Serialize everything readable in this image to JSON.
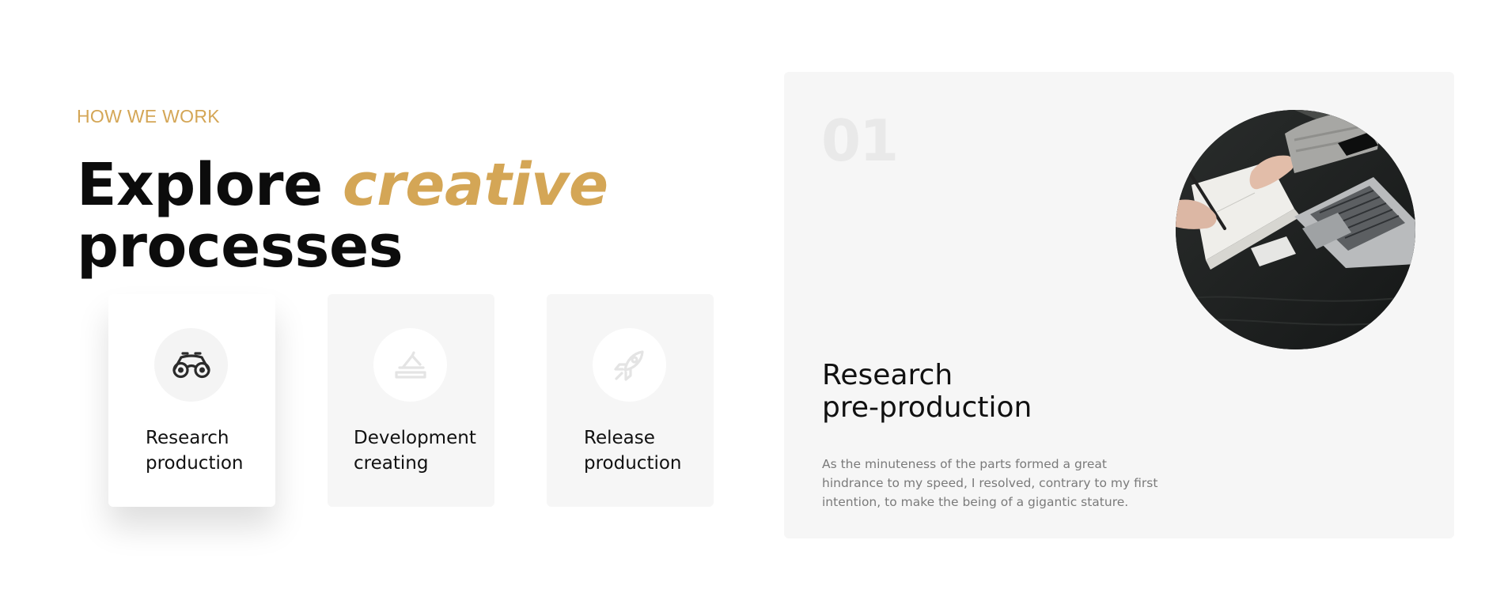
{
  "section": {
    "eyebrow": "HOW WE WORK",
    "headline": {
      "part1": "Explore ",
      "accent": "creative",
      "part2": "processes"
    },
    "accent_color": "#d4a656"
  },
  "cards": [
    {
      "label": "Research production",
      "line1": "Research",
      "line2": "production",
      "icon": "binoculars-icon",
      "active": true
    },
    {
      "label": "Development creating",
      "line1": "Development",
      "line2": "creating",
      "icon": "pen-tool-icon",
      "active": false
    },
    {
      "label": "Release production",
      "line1": "Release",
      "line2": "production",
      "icon": "rocket-icon",
      "active": false
    }
  ],
  "detail": {
    "number": "01",
    "title_line1": "Research",
    "title_line2": "pre-production",
    "description": "As the minuteness of the parts formed a great hindrance to my speed, I resolved, contrary to my first intention, to make the being of a gigantic stature.",
    "image": "photo-of-hands-writing-notebook-beside-laptop"
  }
}
